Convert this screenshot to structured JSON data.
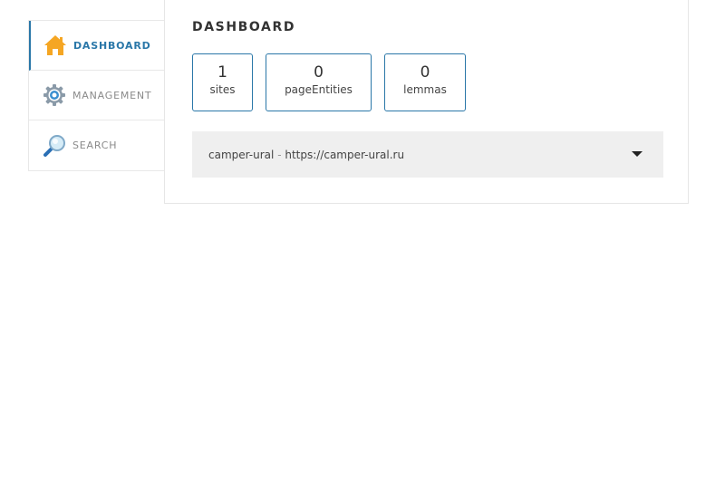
{
  "sidebar": {
    "items": [
      {
        "label": "DASHBOARD",
        "icon": "home-icon",
        "active": true
      },
      {
        "label": "MANAGEMENT",
        "icon": "gear-icon",
        "active": false
      },
      {
        "label": "SEARCH",
        "icon": "magnifier-icon",
        "active": false
      }
    ]
  },
  "main": {
    "title": "DASHBOARD",
    "stats": [
      {
        "value": "1",
        "label": "sites"
      },
      {
        "value": "0",
        "label": "pageEntities"
      },
      {
        "value": "0",
        "label": "lemmas"
      }
    ],
    "site_select": {
      "name": "camper-ural",
      "separator": " - ",
      "url": "https://camper-ural.ru"
    }
  },
  "colors": {
    "accent": "#2a77a8",
    "home_icon": "#f5a623",
    "select_bg": "#efefef"
  }
}
